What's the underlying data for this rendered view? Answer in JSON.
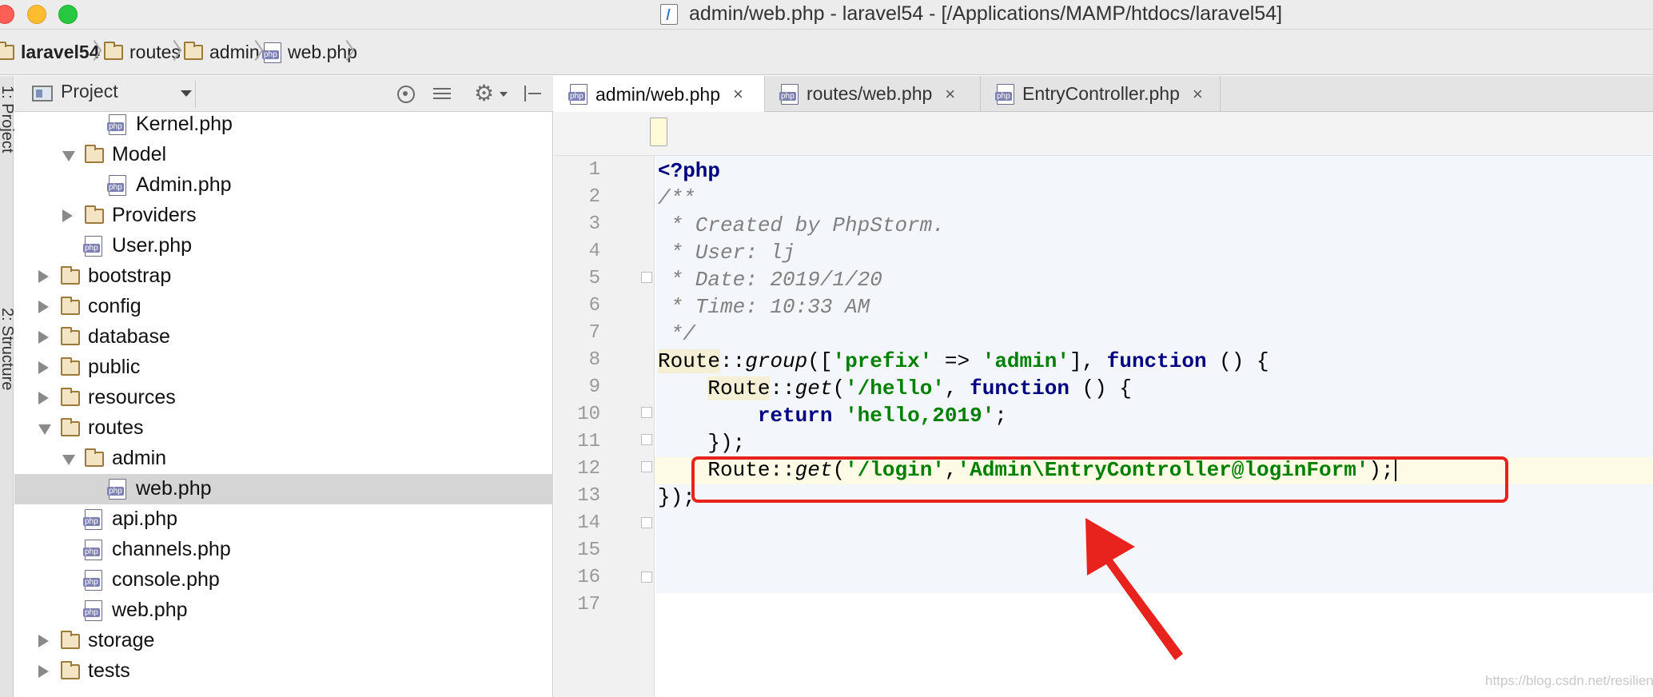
{
  "window": {
    "title": "admin/web.php - laravel54 - [/Applications/MAMP/htdocs/laravel54]"
  },
  "breadcrumb": [
    {
      "label": "laravel54",
      "icon": "folder-icon"
    },
    {
      "label": "routes",
      "icon": "folder-icon"
    },
    {
      "label": "admin",
      "icon": "folder-icon"
    },
    {
      "label": "web.php",
      "icon": "php-file-icon"
    }
  ],
  "side_tabs": {
    "project": "1: Project",
    "structure": "2: Structure"
  },
  "project_panel": {
    "title": "Project",
    "tree": [
      {
        "label": "Kernel.php",
        "type": "php",
        "depth": 4,
        "arrow": "none"
      },
      {
        "label": "Model",
        "type": "folder",
        "depth": 3,
        "arrow": "down"
      },
      {
        "label": "Admin.php",
        "type": "php",
        "depth": 4,
        "arrow": "none"
      },
      {
        "label": "Providers",
        "type": "folder",
        "depth": 3,
        "arrow": "right"
      },
      {
        "label": "User.php",
        "type": "php",
        "depth": 3,
        "arrow": "none"
      },
      {
        "label": "bootstrap",
        "type": "folder",
        "depth": 2,
        "arrow": "right"
      },
      {
        "label": "config",
        "type": "folder",
        "depth": 2,
        "arrow": "right"
      },
      {
        "label": "database",
        "type": "folder",
        "depth": 2,
        "arrow": "right"
      },
      {
        "label": "public",
        "type": "folder",
        "depth": 2,
        "arrow": "right"
      },
      {
        "label": "resources",
        "type": "folder",
        "depth": 2,
        "arrow": "right"
      },
      {
        "label": "routes",
        "type": "folder",
        "depth": 2,
        "arrow": "down"
      },
      {
        "label": "admin",
        "type": "folder",
        "depth": 3,
        "arrow": "down"
      },
      {
        "label": "web.php",
        "type": "php",
        "depth": 4,
        "arrow": "none",
        "selected": true
      },
      {
        "label": "api.php",
        "type": "php",
        "depth": 3,
        "arrow": "none"
      },
      {
        "label": "channels.php",
        "type": "php",
        "depth": 3,
        "arrow": "none"
      },
      {
        "label": "console.php",
        "type": "php",
        "depth": 3,
        "arrow": "none"
      },
      {
        "label": "web.php",
        "type": "php",
        "depth": 3,
        "arrow": "none"
      },
      {
        "label": "storage",
        "type": "folder",
        "depth": 2,
        "arrow": "right"
      },
      {
        "label": "tests",
        "type": "folder",
        "depth": 2,
        "arrow": "right"
      }
    ]
  },
  "tabs": [
    {
      "label": "admin/web.php",
      "active": true
    },
    {
      "label": "routes/web.php",
      "active": false
    },
    {
      "label": "EntryController.php",
      "active": false
    }
  ],
  "tab_close_glyph": "×",
  "code": {
    "lines": [
      "1",
      "2",
      "3",
      "4",
      "5",
      "6",
      "7",
      "8",
      "9",
      "10",
      "11",
      "12",
      "13",
      "14",
      "15",
      "16",
      "17"
    ],
    "l1": "<?php",
    "l2": "/**",
    "l3": " * Created by PhpStorm.",
    "l4": " * User: lj",
    "l5": " * Date: 2019/1/20",
    "l6": " * Time: 10:33 AM",
    "l7": " */",
    "route": "Route",
    "sep": "::",
    "group": "group",
    "get": "get",
    "open_bracket": "([",
    "prefix": "'prefix'",
    "arrow_op": " => ",
    "admin": "'admin'",
    "close_bracket": "], ",
    "function_kw": "function",
    "fn_tail": " () {",
    "paren_open": "(",
    "hello_path": "'/hello'",
    "comma_space": ", ",
    "return_kw": "return",
    "hello_str": "'hello,2019'",
    "semicolon": ";",
    "close_inner": "});",
    "login_path": "'/login'",
    "comma": ",",
    "controller": "'Admin\\EntryController@loginForm'",
    "close_call": ");",
    "close_outer": "});"
  },
  "colors": {
    "keyword": "#000080",
    "string": "#008000",
    "comment": "#808080",
    "annotation": "#e8231e"
  },
  "watermark": "https://blog.csdn.net/resilient"
}
